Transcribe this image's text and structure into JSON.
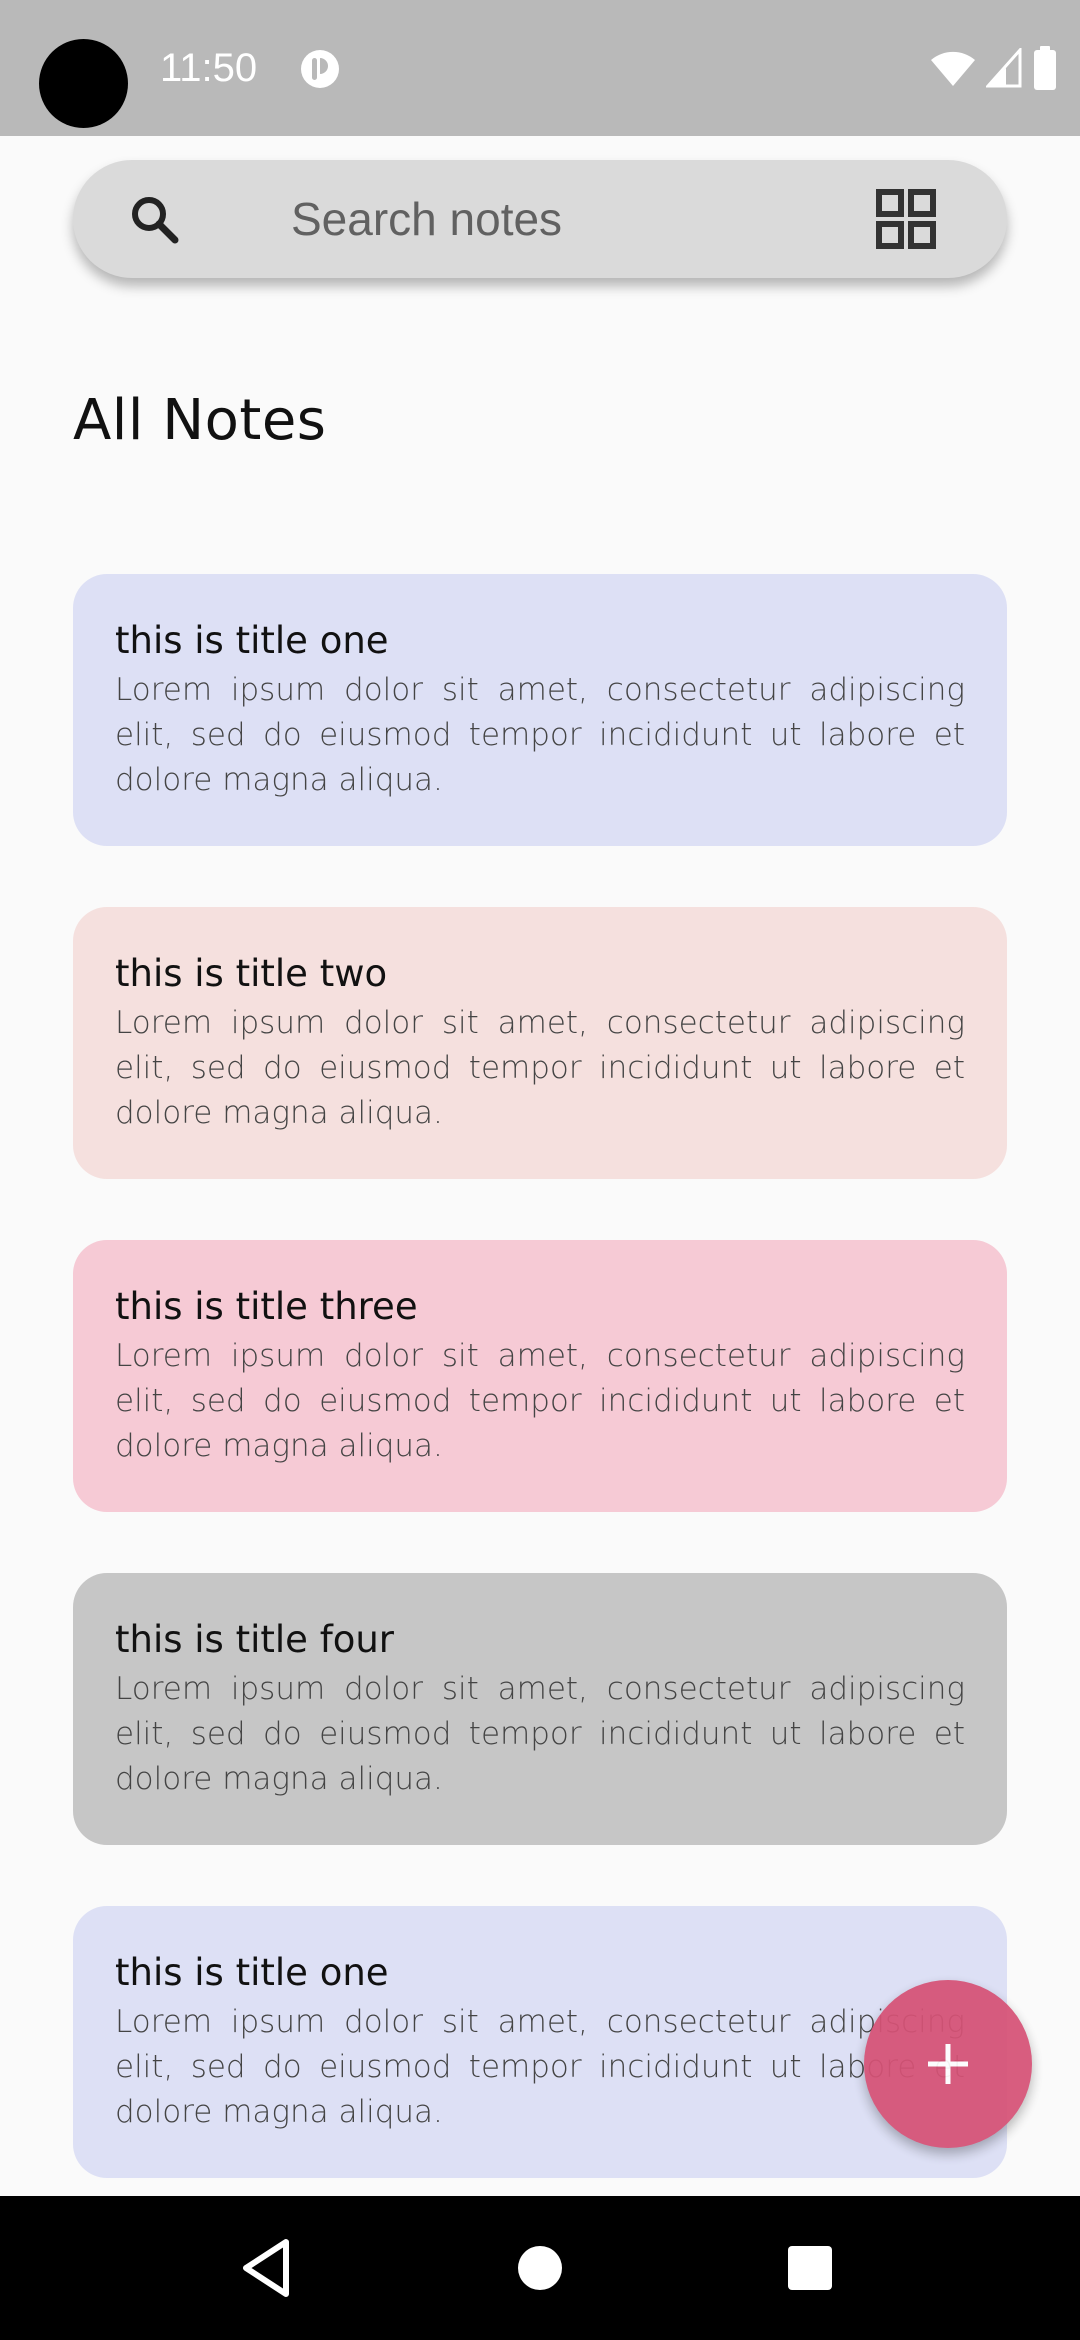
{
  "status_bar": {
    "time": "11:50",
    "icons": [
      "notification-app-icon",
      "wifi-icon",
      "cell-signal-icon",
      "battery-icon"
    ]
  },
  "search": {
    "placeholder": "Search notes",
    "icon": "search-icon",
    "view_toggle_icon": "grid-view-icon"
  },
  "page": {
    "title": "All Notes"
  },
  "notes": [
    {
      "title": "this is title one",
      "body": "Lorem ipsum dolor sit amet, consectetur adipiscing elit, sed do eiusmod tempor incididunt ut labore et dolore magna aliqua.",
      "color": "#dde0f5"
    },
    {
      "title": "this is title two",
      "body": "Lorem ipsum dolor sit amet, consectetur adipiscing elit, sed do eiusmod tempor incididunt ut labore et dolore magna aliqua.",
      "color": "#f5e0de"
    },
    {
      "title": "this is title three",
      "body": "Lorem ipsum dolor sit amet, consectetur adipiscing elit, sed do eiusmod tempor incididunt ut labore et dolore magna aliqua.",
      "color": "#f6cad5"
    },
    {
      "title": "this is title four",
      "body": "Lorem ipsum dolor sit amet, consectetur adipiscing elit, sed do eiusmod tempor incididunt ut labore et dolore magna aliqua.",
      "color": "#c6c6c6"
    },
    {
      "title": "this is title one",
      "body": "Lorem ipsum dolor sit amet, consectetur adipiscing elit, sed do eiusmod tempor incididunt ut labore et dolore magna aliqua.",
      "color": "#dde0f5"
    }
  ],
  "fab": {
    "icon": "plus-icon",
    "color": "#d65276"
  },
  "nav_bar": {
    "buttons": [
      "back-icon",
      "home-icon",
      "recents-icon"
    ]
  }
}
